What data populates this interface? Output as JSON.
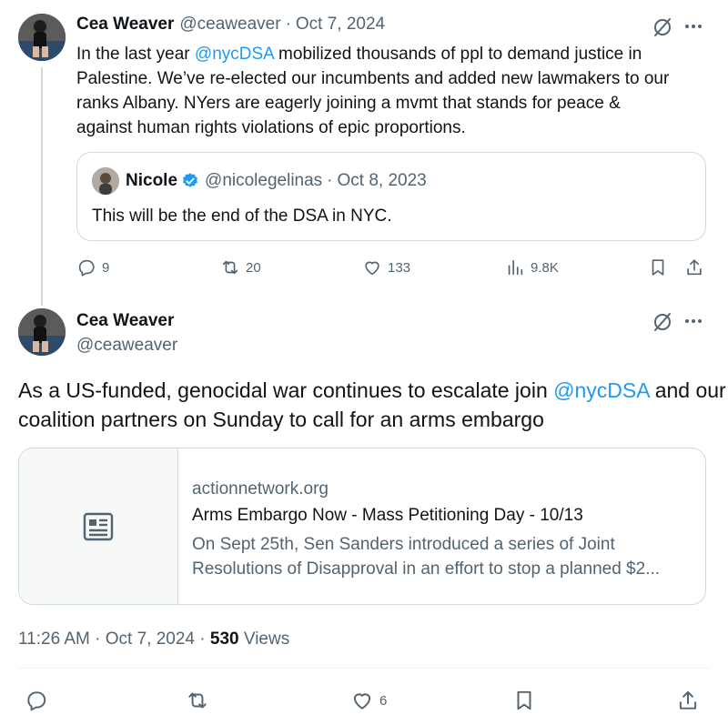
{
  "tweet1": {
    "name": "Cea Weaver",
    "handle": "@ceaweaver",
    "sep": "·",
    "date": "Oct 7, 2024",
    "text_before": "In the last year ",
    "mention": "@nycDSA",
    "text_line1_after": " mobilized thousands of ppl to demand justice in",
    "text_line2": "Palestine. We’ve re-elected our incumbents and added new lawmakers to our",
    "text_line3": "ranks Albany. NYers are eagerly joining a mvmt that stands for peace &",
    "text_line4": "against human rights violations of epic proportions.",
    "quote": {
      "name": "Nicole",
      "handle": "@nicolegelinas",
      "sep": "·",
      "date": "Oct 8, 2023",
      "text": "This will be the end of the DSA in NYC.",
      "verified_color": "#1d9bf0"
    },
    "actions": {
      "replies": "9",
      "reposts": "20",
      "likes": "133",
      "views": "9.8K"
    }
  },
  "tweet2": {
    "name": "Cea Weaver",
    "handle": "@ceaweaver",
    "text_line1_before": "As a US-funded, genocidal war continues to escalate join ",
    "mention": "@nycDSA",
    "text_line1_after": " and our",
    "text_line2": "coalition partners on Sunday  to call for an arms embargo",
    "card": {
      "domain": "actionnetwork.org",
      "title": "Arms Embargo Now - Mass Petitioning Day - 10/13",
      "desc_line1": "On Sept 25th, Sen Sanders introduced a series of Joint",
      "desc_line2": "Resolutions of Disapproval in an effort to stop a planned $2...",
      "thumb_icon": "article-icon"
    },
    "meta": {
      "time": "11:26 AM",
      "sep1": "·",
      "date": "Oct 7, 2024",
      "sep2": "·",
      "views_count": "530",
      "views_label": " Views"
    },
    "actions": {
      "likes": "6"
    }
  },
  "colors": {
    "link": "#1d9bf0",
    "muted": "#536471",
    "text": "#0f1419",
    "border": "#cfd9de"
  }
}
